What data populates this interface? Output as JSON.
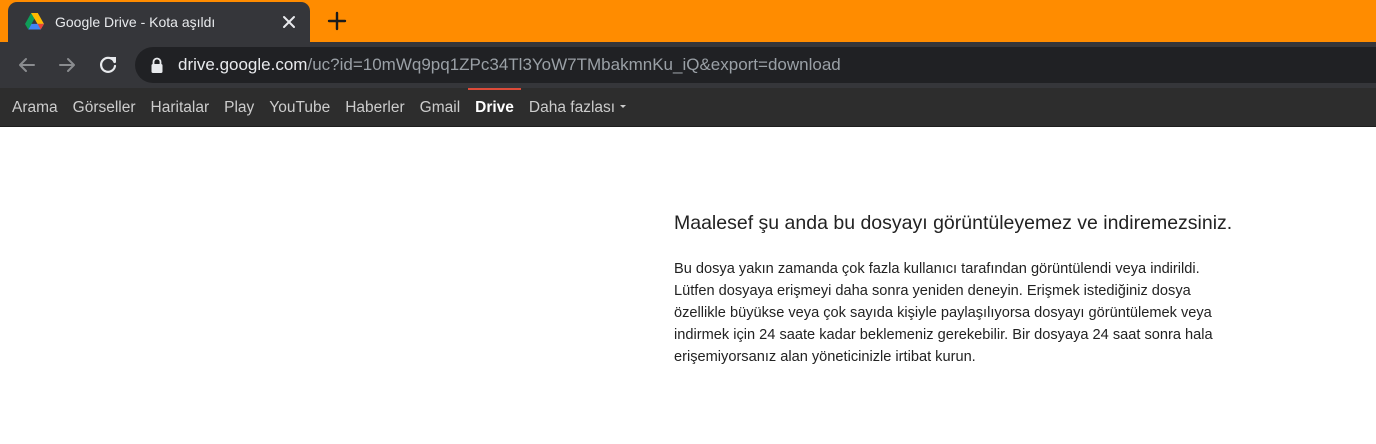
{
  "browser": {
    "tab": {
      "title": "Google Drive - Kota aşıldı",
      "favicon": "google-drive-logo-icon",
      "close_icon": "close-icon"
    },
    "new_tab_icon": "plus-icon",
    "nav": {
      "back_icon": "arrow-left-icon",
      "forward_icon": "arrow-right-icon",
      "reload_icon": "reload-icon"
    },
    "omnibox": {
      "lock_icon": "lock-icon",
      "url_host": "drive.google.com",
      "url_rest": "/uc?id=10mWq9pq1ZPc34Tl3YoW7TMbakmnKu_iQ&export=download"
    },
    "colors": {
      "frame": "#ff8c00",
      "toolbar": "#35363a",
      "omnibox": "#202124",
      "gbar": "#2d2d2d",
      "gbar_active_accent": "#dd4b39"
    }
  },
  "gbar": {
    "items": [
      {
        "label": "Arama"
      },
      {
        "label": "Görseller"
      },
      {
        "label": "Haritalar"
      },
      {
        "label": "Play"
      },
      {
        "label": "YouTube"
      },
      {
        "label": "Haberler"
      },
      {
        "label": "Gmail"
      },
      {
        "label": "Drive",
        "active": true
      },
      {
        "label": "Daha fazlası",
        "dropdown_icon": "caret-down-icon"
      }
    ]
  },
  "main": {
    "heading": "Maalesef şu anda bu dosyayı görüntüleyemez ve indiremezsiniz.",
    "message": "Bu dosya yakın zamanda çok fazla kullanıcı tarafından görüntülendi veya indirildi. Lütfen dosyaya erişmeyi daha sonra yeniden deneyin. Erişmek istediğiniz dosya özellikle büyükse veya çok sayıda kişiyle paylaşılıyorsa dosyayı görüntülemek veya indirmek için 24 saate kadar beklemeniz gerekebilir. Bir dosyaya 24 saat sonra hala erişemiyorsanız alan yöneticinizle irtibat kurun."
  }
}
